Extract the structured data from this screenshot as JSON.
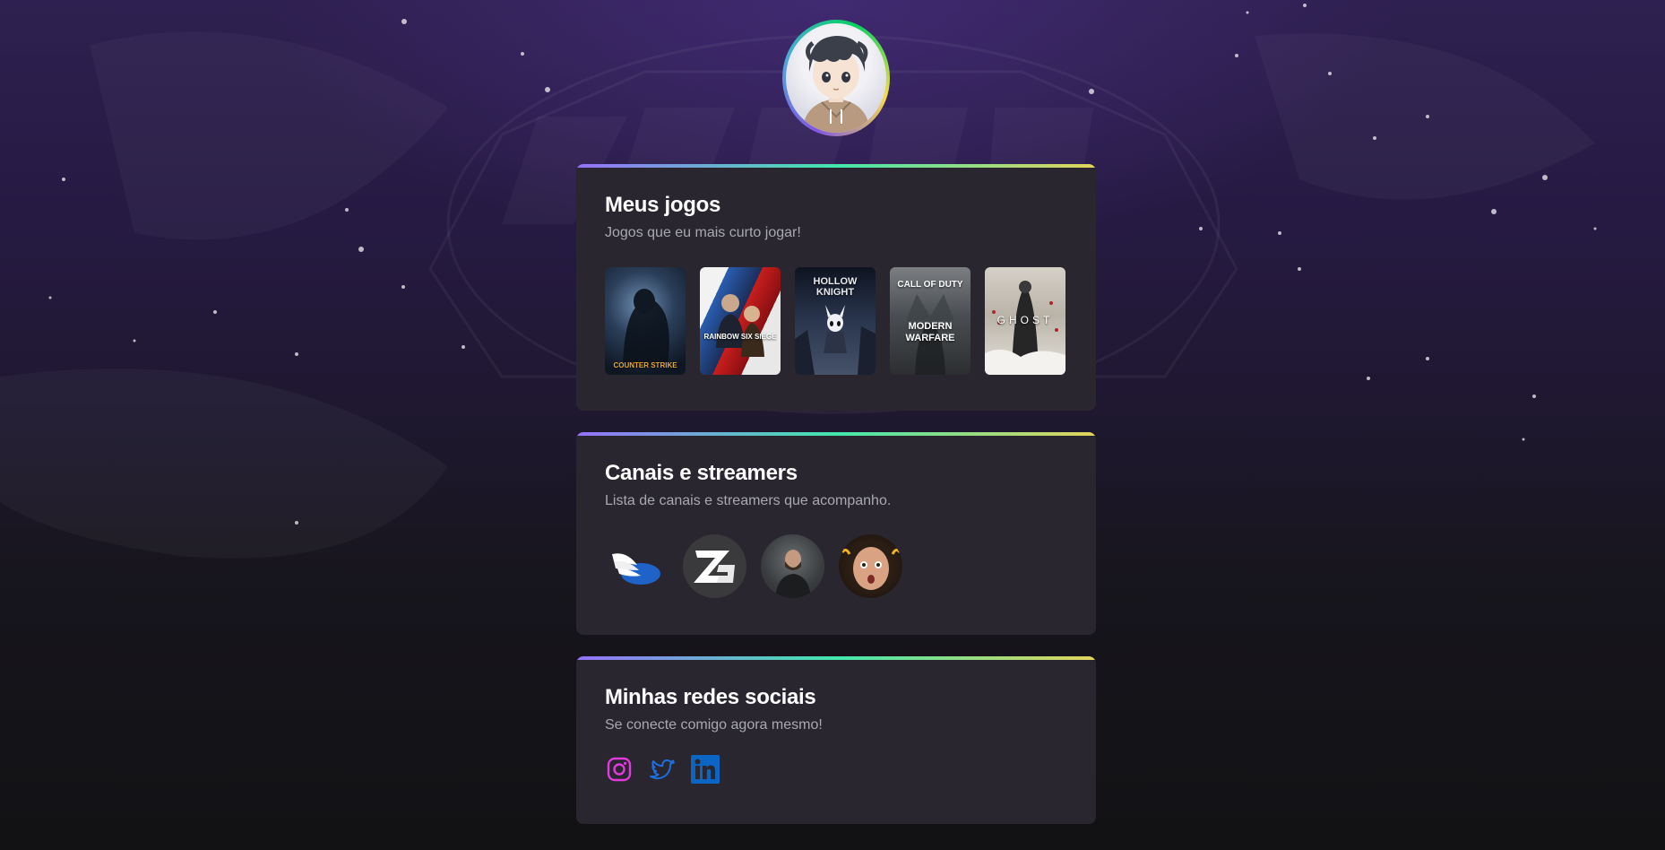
{
  "profile": {
    "avatar": "anime-boy-avatar"
  },
  "games_section": {
    "title": "Meus jogos",
    "subtitle": "Jogos que eu mais curto jogar!",
    "games": [
      {
        "name": "Counter Strike",
        "cover_text": "COUNTER STRIKE"
      },
      {
        "name": "Rainbow Six Siege",
        "cover_text": "RAINBOW SIX SIEGE"
      },
      {
        "name": "Hollow Knight",
        "cover_text": "HOLLOW KNIGHT"
      },
      {
        "name": "Call of Duty Modern Warfare",
        "cover_text": "CALL OF DUTY",
        "cover_text2": "MODERN WARFARE"
      },
      {
        "name": "Ghost of Tsushima",
        "cover_text": "GHOST"
      }
    ]
  },
  "streamers_section": {
    "title": "Canais e streamers",
    "subtitle": "Lista de canais e streamers que acompanho."
  },
  "social_section": {
    "title": "Minhas redes sociais",
    "subtitle": "Se conecte comigo agora mesmo!",
    "links": [
      "instagram-icon",
      "twitter-icon",
      "linkedin-icon"
    ]
  },
  "colors": {
    "card_bg": "#29262f",
    "accent_gradient": [
      "#9572fc",
      "#43e7ad",
      "#e2d45c"
    ],
    "instagram": "#e03bdc",
    "twitter": "#1d6fe0",
    "linkedin": "#0a66c2"
  }
}
